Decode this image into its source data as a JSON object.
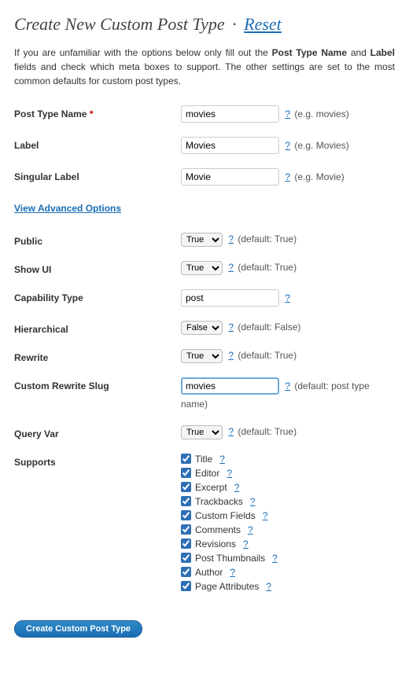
{
  "header": {
    "title": "Create New Custom Post Type",
    "separator": "·",
    "reset": "Reset"
  },
  "intro": {
    "pre": "If you are unfamiliar with the options below only fill out the ",
    "b1": "Post Type Name",
    "mid": " and ",
    "b2": "Label",
    "post": " fields and check which meta boxes to support. The other settings are set to the most common defaults for custom post types."
  },
  "fields": {
    "post_type_name": {
      "label": "Post Type Name",
      "required": "*",
      "value": "movies",
      "hint": "(e.g. movies)"
    },
    "label": {
      "label": "Label",
      "value": "Movies",
      "hint": "(e.g. Movies)"
    },
    "singular_label": {
      "label": "Singular Label",
      "value": "Movie",
      "hint": "(e.g. Movie)"
    }
  },
  "advanced_link": "View Advanced Options",
  "adv": {
    "public": {
      "label": "Public",
      "value": "True",
      "hint": "(default: True)"
    },
    "show_ui": {
      "label": "Show UI",
      "value": "True",
      "hint": "(default: True)"
    },
    "capability_type": {
      "label": "Capability Type",
      "value": "post"
    },
    "hierarchical": {
      "label": "Hierarchical",
      "value": "False",
      "hint": "(default: False)"
    },
    "rewrite": {
      "label": "Rewrite",
      "value": "True",
      "hint": "(default: True)"
    },
    "custom_rewrite_slug": {
      "label": "Custom Rewrite Slug",
      "value": "movies",
      "hint_pre": "(default: post type",
      "hint_post": "name)"
    },
    "query_var": {
      "label": "Query Var",
      "value": "True",
      "hint": "(default: True)"
    }
  },
  "help": "?",
  "supports": {
    "label": "Supports",
    "items": [
      {
        "label": "Title",
        "checked": true
      },
      {
        "label": "Editor",
        "checked": true
      },
      {
        "label": "Excerpt",
        "checked": true
      },
      {
        "label": "Trackbacks",
        "checked": true
      },
      {
        "label": "Custom Fields",
        "checked": true
      },
      {
        "label": "Comments",
        "checked": true
      },
      {
        "label": "Revisions",
        "checked": true
      },
      {
        "label": "Post Thumbnails",
        "checked": true
      },
      {
        "label": "Author",
        "checked": true
      },
      {
        "label": "Page Attributes",
        "checked": true
      }
    ]
  },
  "submit": "Create Custom Post Type",
  "bool_options": {
    "t": "True",
    "f": "False"
  }
}
